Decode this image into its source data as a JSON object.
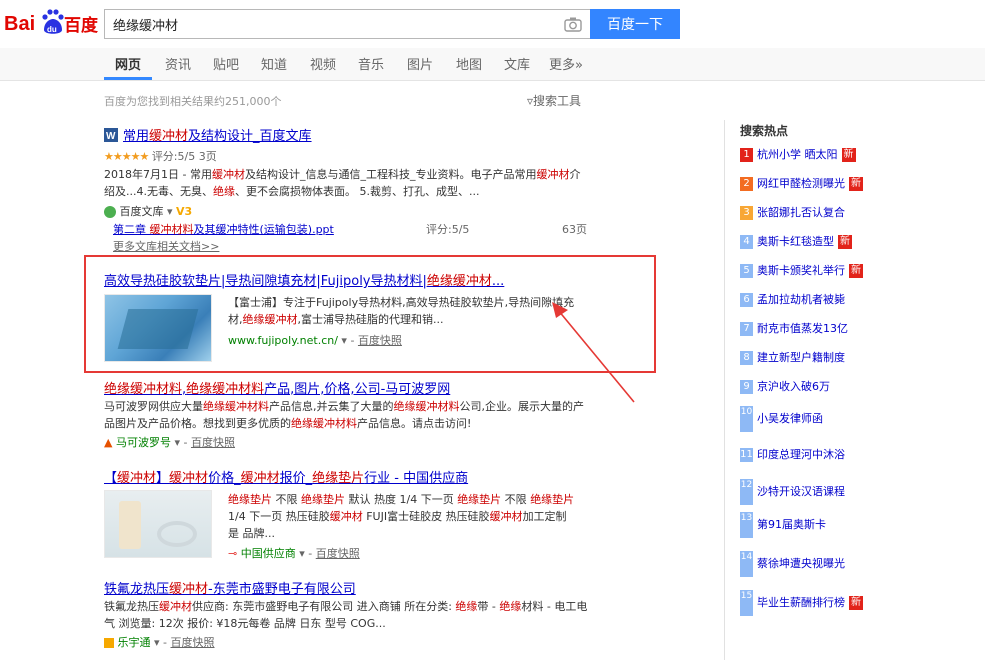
{
  "header": {
    "logo_text": "Bai百度",
    "search_value": "绝缘缓冲材",
    "search_button": "百度一下"
  },
  "tabs": [
    "网页",
    "资讯",
    "贴吧",
    "知道",
    "视频",
    "音乐",
    "图片",
    "地图",
    "文库",
    "更多»"
  ],
  "result_count": "百度为您找到相关结果约251,000个",
  "search_tools": "搜索工具",
  "results": [
    {
      "title": "常用缓冲材及结构设计_百度文库",
      "rating_label": "评分:5/5 3页",
      "snippet": "2018年7月1日 - 常用缓冲材及结构设计_信息与通信_工程科技_专业资料。电子产品常用缓冲材介绍及...4.无毒、无臭、绝缘、更不会腐损物体表面。 5.裁剪、打孔、成型、...",
      "source": "百度文库",
      "sub_doc_title": "第二章 缓冲材料及其缓冲特性(运输包装).ppt",
      "sub_doc_rating": "评分:5/5",
      "sub_doc_pages": "63页",
      "more_docs": "更多文库相关文档>>"
    },
    {
      "title": "高效导热硅胶软垫片|导热间隙填充材|Fujipoly导热材料|绝缘缓冲材...",
      "snippet": "【富士浦】专注于Fujipoly导热材料,高效导热硅胶软垫片,导热间隙填充材,绝缘缓冲材,富士浦导热硅脂的代理和销...",
      "url": "www.fujipoly.net.cn/",
      "snapshot": "百度快照"
    },
    {
      "title": "绝缘缓冲材料,绝缘缓冲材料产品,图片,价格,公司-马可波罗网",
      "snippet": "马可波罗网供应大量绝缘缓冲材料产品信息,并云集了大量的绝缘缓冲材料公司,企业。展示大量的产品图片及产品价格。想找到更多优质的绝缘缓冲材料产品信息。请点击访问!",
      "source": "马可波罗号",
      "snapshot": "百度快照"
    },
    {
      "title": "【缓冲材】缓冲材价格_缓冲材报价_绝缘垫片行业 - 中国供应商",
      "snippet": "绝缘垫片 不限 绝缘垫片 默认 热度 1/4 下一页 绝缘垫片 不限 绝缘垫片 1/4 下一页 热压硅胶缓冲材 FUJI富士硅胶皮 热压硅胶缓冲材加工定制 是 品牌...",
      "source": "中国供应商",
      "snapshot": "百度快照"
    },
    {
      "title": "铁氟龙热压缓冲材-东莞市盛野电子有限公司",
      "snippet": "铁氟龙热压缓冲材供应商: 东莞市盛野电子有限公司 进入商铺 所在分类: 绝缘带 - 绝缘材料 - 电工电气 浏览量: 12次 报价: ¥18元每卷 品牌 日东 型号 COG...",
      "source": "乐宇通",
      "snapshot": "百度快照"
    }
  ],
  "hot": {
    "title": "搜索热点",
    "items": [
      {
        "num": "1",
        "text": "杭州小学 晒太阳",
        "new": "新"
      },
      {
        "num": "2",
        "text": "网红甲醛检测曝光",
        "new": "新"
      },
      {
        "num": "3",
        "text": "张韶娜扎否认复合",
        "new": ""
      },
      {
        "num": "4",
        "text": "奥斯卡红毯造型",
        "new": "新"
      },
      {
        "num": "5",
        "text": "奥斯卡颁奖礼举行",
        "new": "新"
      },
      {
        "num": "6",
        "text": "孟加拉劫机者被毙",
        "new": ""
      },
      {
        "num": "7",
        "text": "耐克市值蒸发13亿",
        "new": ""
      },
      {
        "num": "8",
        "text": "建立新型户籍制度",
        "new": ""
      },
      {
        "num": "9",
        "text": "京沪收入破6万",
        "new": ""
      },
      {
        "num": "10",
        "text": "小吴发律师函",
        "new": ""
      },
      {
        "num": "11",
        "text": "印度总理河中沐浴",
        "new": ""
      },
      {
        "num": "12",
        "text": "沙特开设汉语课程",
        "new": ""
      },
      {
        "num": "13",
        "text": "第91届奥斯卡",
        "new": ""
      },
      {
        "num": "14",
        "text": "蔡徐坤遭央视曝光",
        "new": ""
      },
      {
        "num": "15",
        "text": "毕业生薪酬排行榜",
        "new": "新"
      }
    ]
  },
  "colors": {
    "brand_blue": "#3385ff",
    "link": "#0000cc",
    "keyword": "#cc0000",
    "highlight_box": "#e53935"
  }
}
